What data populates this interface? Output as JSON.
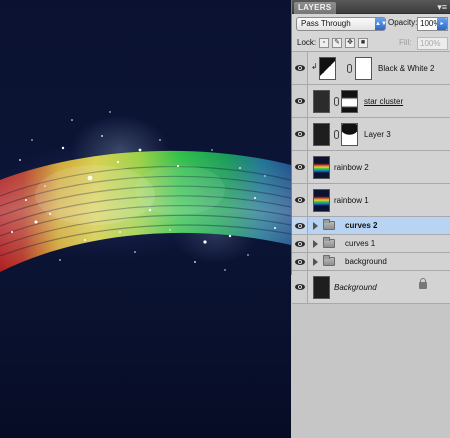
{
  "panel": {
    "tab_label": "LAYERS",
    "menu_icon": "panel-menu-icon",
    "blend_mode": "Pass Through",
    "opacity_label": "Opacity:",
    "opacity_value": "100%",
    "lock_label": "Lock:",
    "fill_label": "Fill:",
    "fill_value": "100%"
  },
  "layers": [
    {
      "name": "Black & White 2",
      "type": "adjustment",
      "visible": true,
      "selected": false
    },
    {
      "name": "star cluster",
      "type": "smart-masked",
      "visible": true,
      "selected": false
    },
    {
      "name": "Layer 3",
      "type": "masked",
      "visible": true,
      "selected": false
    },
    {
      "name": "rainbow 2",
      "type": "pixel",
      "visible": true,
      "selected": false
    },
    {
      "name": "rainbow 1",
      "type": "pixel",
      "visible": true,
      "selected": false
    },
    {
      "name": "curves 2",
      "type": "group",
      "visible": true,
      "selected": true
    },
    {
      "name": "curves 1",
      "type": "group",
      "visible": true,
      "selected": false
    },
    {
      "name": "background",
      "type": "group",
      "visible": true,
      "selected": false
    },
    {
      "name": "Background",
      "type": "locked-background",
      "visible": true,
      "selected": false
    }
  ],
  "colors": {
    "canvas_bg": "#0b1231",
    "panel_bg": "#d9d9d9",
    "selection": "#b9d4f3",
    "accent_blue": "#2d68c9"
  }
}
